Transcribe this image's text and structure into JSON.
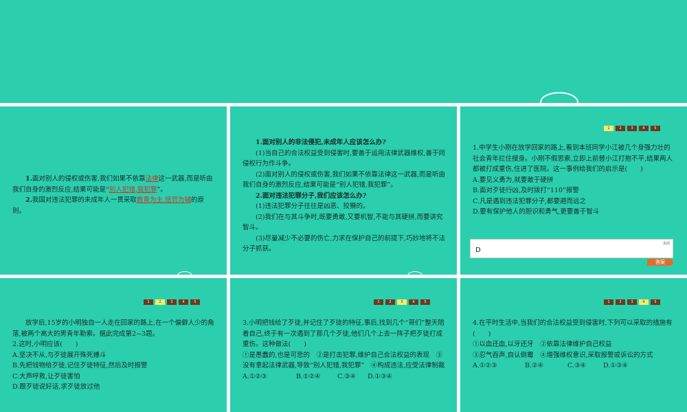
{
  "slides": {
    "s1": {
      "item1_prefix": "1.",
      "item1_text_a": "面对别人的侵权或伤害,我们如果不依靠",
      "item1_blank1": "法律",
      "item1_text_b": "这一武器,而是听由我们自身的激烈反应,结果可能是“",
      "item1_blank2": "别人犯错,我犯罪",
      "item1_text_c": "”。",
      "item2_prefix": "2.",
      "item2_text_a": "我国对违法犯罪的未成年人一贯采取",
      "item2_blank": "教育为主,惩罚为辅",
      "item2_text_b": "的原则。"
    },
    "s2": {
      "h1": "1.面对别人的非法侵犯,未成年人应该怎么办?",
      "p1": "(1)当自己的合法权益受到侵害时,要善于运用法律武器维权,善于同侵权行为作斗争。",
      "p2": "(2)面对别人的侵权或伤害,我们如果不依靠法律这一武器,而是听由我们自身的激烈反应,结果可能是“别人犯错,我犯罪”。",
      "h2": "2.面对违法犯罪分子,我们应该怎么办?",
      "p3": "(1)违法犯罪分子往往是凶恶、狡猾的。",
      "p4": "(2)我们在与其斗争时,既要勇敢,又要机智,不能与其硬拼,而要讲究智斗。",
      "p5": "(3)尽量减少不必要的伤亡,力求在保护自己的前提下,巧妙地将不法分子抓获。"
    },
    "s3": {
      "pager": [
        "1",
        "2",
        "3",
        "4",
        "5"
      ],
      "question": "1.中学生小刚在放学回家的路上,看到本班同学小江被几个身强力壮的社会青年拦住搜身。小刚不假思索,立即上前替小江打抱不平,结果两人都被打成重伤,住进了医院。这一事例给我们的启示是(　　)",
      "options": [
        "A.要见义勇为,就要敢于硬拼",
        "B.面对歹徒行凶,及时拨打“110”报警",
        "C.凡是遇到违法犯罪分子,都要避而远之",
        "D.要有保护他人的胆识和勇气,更要善于智斗"
      ],
      "answer": "D",
      "close_label": "关闭",
      "answer_tab": "答案"
    },
    "s4": {
      "pager": [
        "1",
        "2",
        "3",
        "4",
        "5"
      ],
      "intro": "放学后,15岁的小明独自一人走在回家的路上,在一个偏僻人少的角落,被两个高大的男青年勒索。据此完成第2~3题。",
      "question": "2.这时,小明应该(　　)",
      "options": [
        "A.坚决不从,与歹徒展开殊死搏斗",
        "B.先把钱物给歹徒,记住歹徒特征,然后及时报警",
        "C.大声呼救,让歹徒害怕",
        "D.跟歹徒说好话,求歹徒放过他"
      ]
    },
    "s5": {
      "pager": [
        "1",
        "2",
        "3",
        "4",
        "5"
      ],
      "question": "3.小明把钱给了歹徒,并记住了歹徒的特征,事后,找到几个“哥们”整天陪着自己,终于有一次遇到了那几个歹徒,他们几个上去一阵子把歹徒打成重伤。这种做法(　　)",
      "statements": "①是愚蠢的,也是可悲的　②是打击犯罪,维护自己合法权益的表现　③没有拿起法律武器,导致“别人犯错,我犯罪”　④构成违法,应受法律制裁",
      "options": [
        "A.①②③",
        "B.①②④",
        "C.③④",
        "D.①③④"
      ]
    },
    "s6": {
      "pager": [
        "1",
        "2",
        "3",
        "4",
        "5"
      ],
      "question": "4.在平时生活中,当我们的合法权益受到侵害时,下列可以采取的措施有(　　)",
      "line1": "①以血还血,以牙还牙　②依靠法律维护自己权益",
      "line2": "③忍气吞声,自认倒霉　④增强维权意识,采取报警或诉讼的方式",
      "options": [
        "A.①②③",
        "B.②④",
        "C.③④",
        "D.①③④"
      ]
    }
  },
  "colors": {
    "background": "#2bcfae",
    "pager": "#6b3a1f",
    "pager_active": "#f7ec6b",
    "fill_text": "#c0392b",
    "answer_tab": "#e86a2f"
  }
}
